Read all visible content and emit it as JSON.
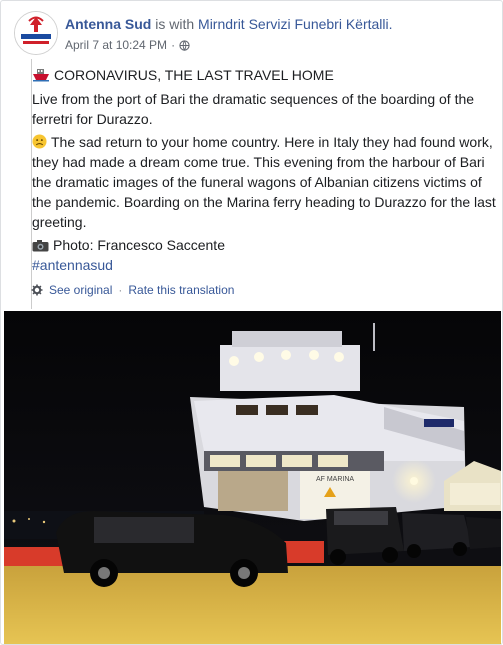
{
  "post": {
    "page_name": "Antenna Sud",
    "with_text": "is with",
    "tagged_page": "Mirndrit Servizi Funebri Kërtalli.",
    "timestamp": "April 7 at 10:24 PM",
    "separator": "·",
    "avatar_text": "ANTENNA SUD",
    "avatar_subtext": "16 NEWS & CANALI",
    "title": "CORONAVIRUS, THE LAST TRAVEL HOME",
    "title_icon": "ship-icon",
    "paragraph1": "Live from the port of Bari the dramatic sequences of the boarding of the ferretri for Durazzo.",
    "paragraph2": "The sad return to your home country. Here in Italy they had found work, they had made a dream come true. This evening from the harbour of Bari the dramatic images of the funeral wagons of Albanian citizens victims of the pandemic. Boarding on the Marina ferry heading to Durazzo for the last greeting.",
    "paragraph2_icon": "sad-face-icon",
    "photo_credit": "Photo: Francesco Saccente",
    "photo_icon": "camera-icon",
    "hashtag": "#antennasud",
    "see_original": "See original",
    "rate_translation": "Rate this translation",
    "ship_name": "AF MARINA"
  },
  "colors": {
    "link": "#385898",
    "meta": "#616770",
    "text": "#1c1e21",
    "logo_red": "#d0202a"
  }
}
